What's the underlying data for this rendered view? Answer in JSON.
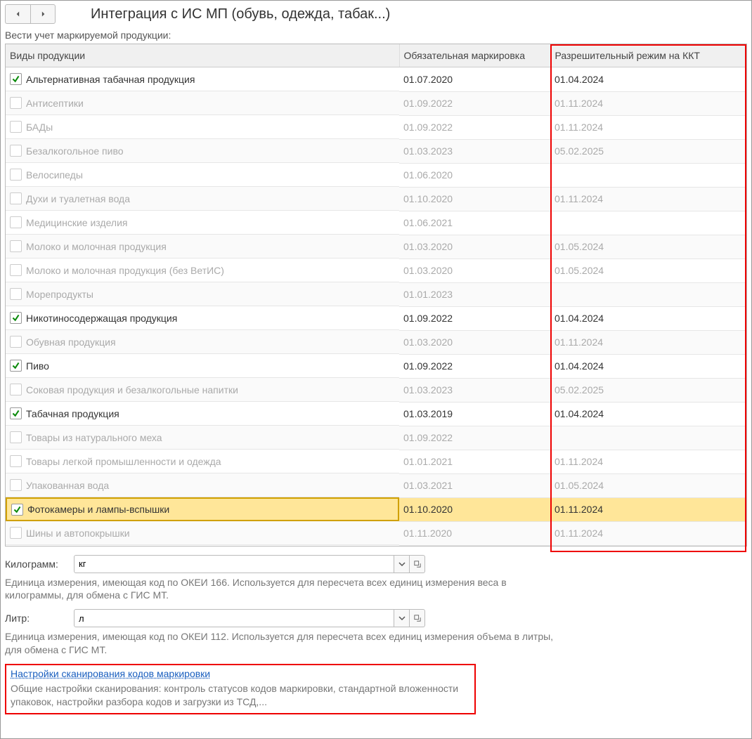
{
  "header": {
    "title": "Интеграция с ИС МП (обувь, одежда, табак...)"
  },
  "subtitle": "Вести учет маркируемой продукции:",
  "columns": {
    "products": "Виды продукции",
    "mandatory": "Обязательная маркировка",
    "kkt": "Разрешительный режим на ККТ"
  },
  "rows": [
    {
      "checked": true,
      "enabled": true,
      "selected": false,
      "name": "Альтернативная табачная продукция",
      "mandatory": "01.07.2020",
      "kkt": "01.04.2024"
    },
    {
      "checked": false,
      "enabled": false,
      "selected": false,
      "name": "Антисептики",
      "mandatory": "01.09.2022",
      "kkt": "01.11.2024"
    },
    {
      "checked": false,
      "enabled": false,
      "selected": false,
      "name": "БАДы",
      "mandatory": "01.09.2022",
      "kkt": "01.11.2024"
    },
    {
      "checked": false,
      "enabled": false,
      "selected": false,
      "name": "Безалкогольное пиво",
      "mandatory": "01.03.2023",
      "kkt": "05.02.2025"
    },
    {
      "checked": false,
      "enabled": false,
      "selected": false,
      "name": "Велосипеды",
      "mandatory": "01.06.2020",
      "kkt": ""
    },
    {
      "checked": false,
      "enabled": false,
      "selected": false,
      "name": "Духи и туалетная вода",
      "mandatory": "01.10.2020",
      "kkt": "01.11.2024"
    },
    {
      "checked": false,
      "enabled": false,
      "selected": false,
      "name": "Медицинские изделия",
      "mandatory": "01.06.2021",
      "kkt": ""
    },
    {
      "checked": false,
      "enabled": false,
      "selected": false,
      "name": "Молоко и молочная продукция",
      "mandatory": "01.03.2020",
      "kkt": "01.05.2024"
    },
    {
      "checked": false,
      "enabled": false,
      "selected": false,
      "name": "Молоко и молочная продукция (без ВетИС)",
      "mandatory": "01.03.2020",
      "kkt": "01.05.2024"
    },
    {
      "checked": false,
      "enabled": false,
      "selected": false,
      "name": "Морепродукты",
      "mandatory": "01.01.2023",
      "kkt": ""
    },
    {
      "checked": true,
      "enabled": true,
      "selected": false,
      "name": "Никотиносодержащая продукция",
      "mandatory": "01.09.2022",
      "kkt": "01.04.2024"
    },
    {
      "checked": false,
      "enabled": false,
      "selected": false,
      "name": "Обувная продукция",
      "mandatory": "01.03.2020",
      "kkt": "01.11.2024"
    },
    {
      "checked": true,
      "enabled": true,
      "selected": false,
      "name": "Пиво",
      "mandatory": "01.09.2022",
      "kkt": "01.04.2024"
    },
    {
      "checked": false,
      "enabled": false,
      "selected": false,
      "name": "Соковая продукция и безалкогольные напитки",
      "mandatory": "01.03.2023",
      "kkt": "05.02.2025"
    },
    {
      "checked": true,
      "enabled": true,
      "selected": false,
      "name": "Табачная продукция",
      "mandatory": "01.03.2019",
      "kkt": "01.04.2024"
    },
    {
      "checked": false,
      "enabled": false,
      "selected": false,
      "name": "Товары из натурального меха",
      "mandatory": "01.09.2022",
      "kkt": ""
    },
    {
      "checked": false,
      "enabled": false,
      "selected": false,
      "name": "Товары легкой промышленности и одежда",
      "mandatory": "01.01.2021",
      "kkt": "01.11.2024"
    },
    {
      "checked": false,
      "enabled": false,
      "selected": false,
      "name": "Упакованная вода",
      "mandatory": "01.03.2021",
      "kkt": "01.05.2024"
    },
    {
      "checked": true,
      "enabled": true,
      "selected": true,
      "name": "Фотокамеры и лампы-вспышки",
      "mandatory": "01.10.2020",
      "kkt": "01.11.2024"
    },
    {
      "checked": false,
      "enabled": false,
      "selected": false,
      "name": "Шины и автопокрышки",
      "mandatory": "01.11.2020",
      "kkt": "01.11.2024"
    }
  ],
  "kg": {
    "label": "Килограмм:",
    "value": "кг",
    "desc": "Единица измерения, имеющая код по ОКЕИ 166. Используется для пересчета всех единиц измерения веса в килограммы, для обмена с ГИС МТ."
  },
  "liter": {
    "label": "Литр:",
    "value": "л",
    "desc": "Единица измерения, имеющая код по ОКЕИ 112. Используется для пересчета всех единиц измерения объема в литры, для обмена с ГИС МТ."
  },
  "scan": {
    "link": "Настройки сканирования кодов маркировки",
    "desc": "Общие настройки сканирования: контроль статусов кодов маркировки, стандартной вложенности упаковок, настройки разбора кодов и загрузки из ТСД,..."
  }
}
